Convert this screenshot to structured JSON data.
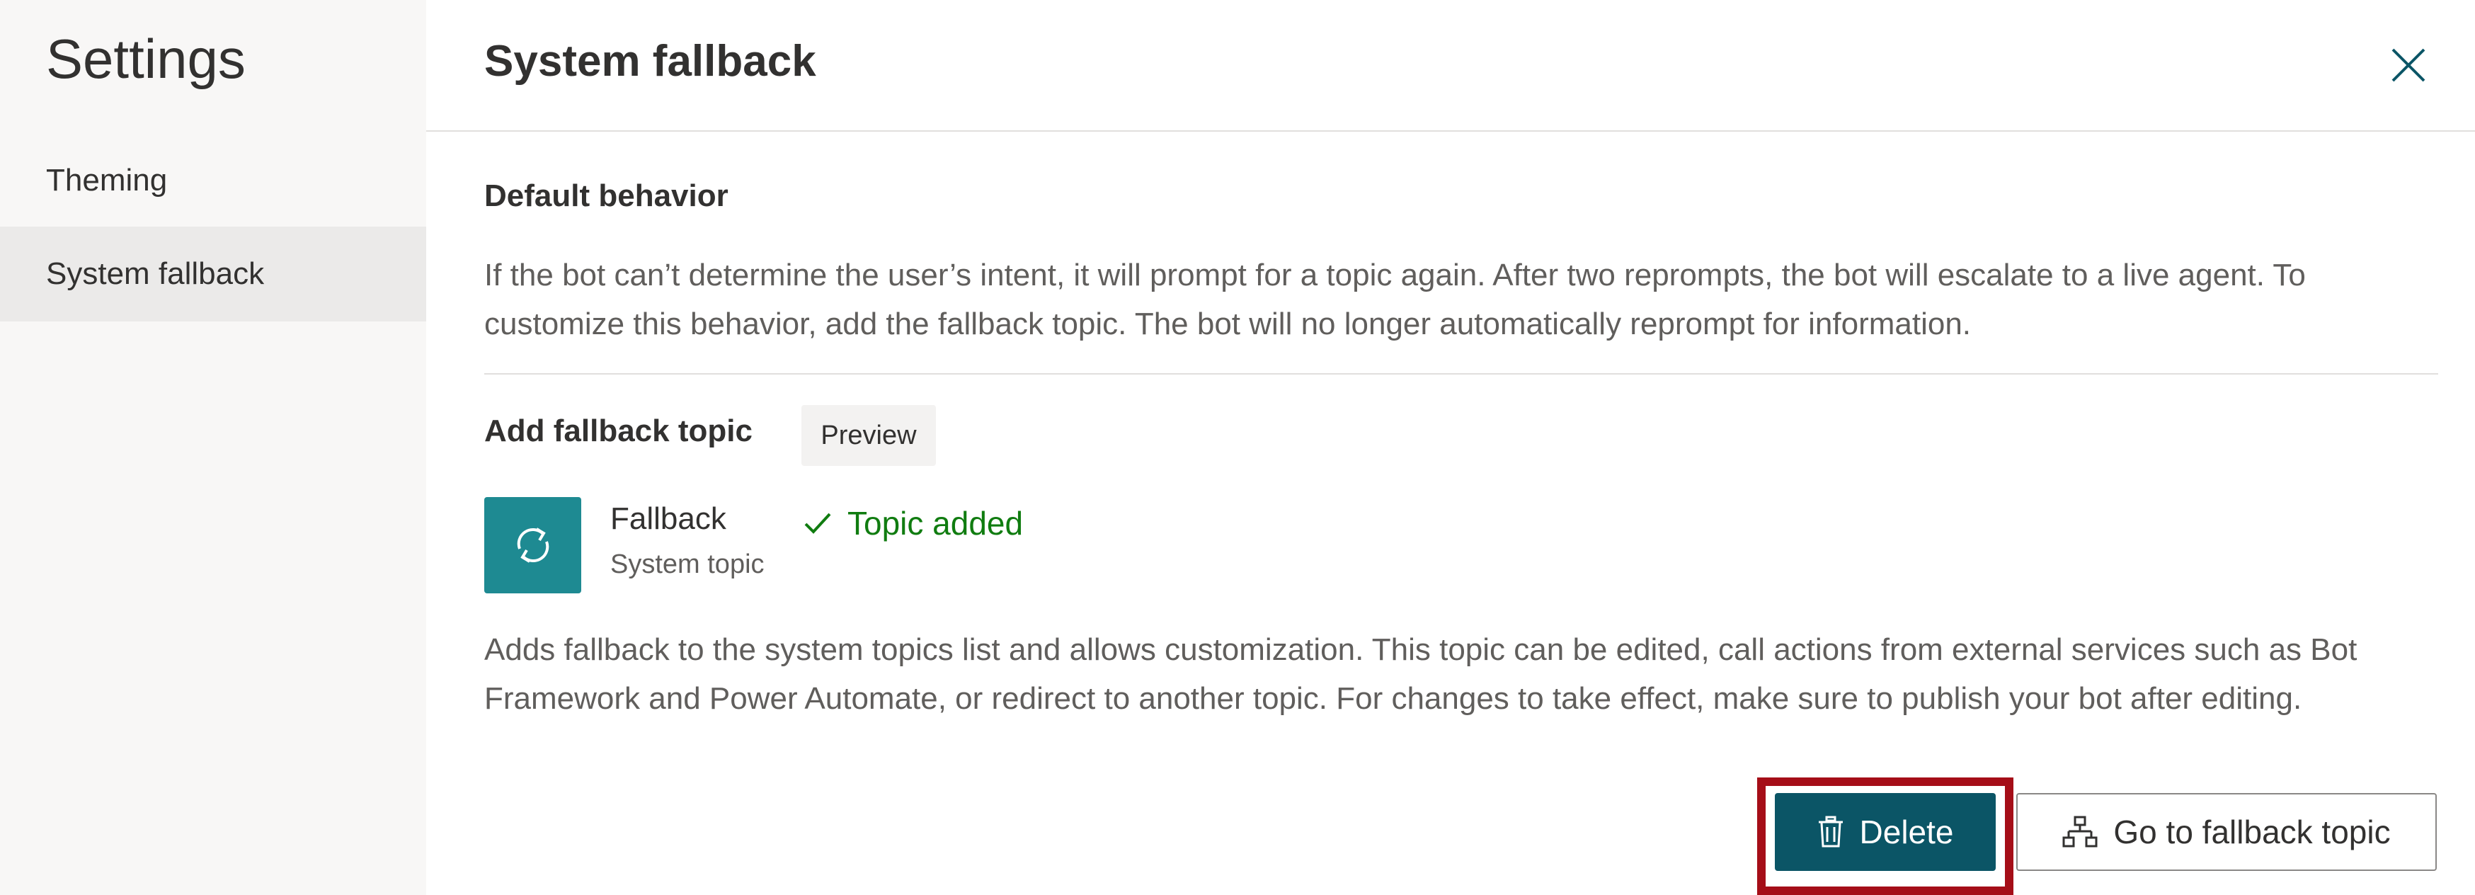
{
  "sidebar": {
    "title": "Settings",
    "items": [
      {
        "label": "Theming"
      },
      {
        "label": "System fallback",
        "selected": true
      }
    ]
  },
  "panel": {
    "title": "System fallback",
    "close_icon": "close-icon"
  },
  "default_behavior": {
    "heading": "Default behavior",
    "description": "If the bot can’t determine the user’s intent, it will prompt for a topic again. After two reprompts, the bot will escalate to a live agent. To customize this behavior, add the fallback topic. The bot will no longer automatically reprompt for information."
  },
  "fallback_topic": {
    "heading": "Add fallback topic",
    "badge": "Preview",
    "topic_name": "Fallback",
    "topic_type": "System topic",
    "status": "Topic added",
    "status_color": "#107c10",
    "tile_color": "#1e8a92",
    "description": "Adds fallback to the system topics list and allows customization. This topic can be edited, call actions from external services such as Bot Framework and Power Automate, or redirect to another topic. For changes to take effect, make sure to publish your bot after editing."
  },
  "actions": {
    "delete_label": "Delete",
    "goto_label": "Go to fallback topic",
    "delete_color": "#0b5566",
    "highlight_color": "#a50e18"
  }
}
